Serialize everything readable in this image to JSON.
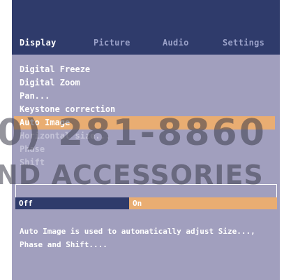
{
  "tabs": [
    {
      "label": "Display",
      "active": true
    },
    {
      "label": "Picture",
      "active": false
    },
    {
      "label": "Audio",
      "active": false
    },
    {
      "label": "Settings",
      "active": false
    }
  ],
  "menu": {
    "items": [
      {
        "label": "Digital Freeze",
        "state": "normal"
      },
      {
        "label": "Digital Zoom",
        "state": "normal"
      },
      {
        "label": "Pan...",
        "state": "normal"
      },
      {
        "label": "Keystone correction",
        "state": "normal"
      },
      {
        "label": "Auto Image",
        "state": "selected"
      },
      {
        "label": "Horizontal size...",
        "state": "disabled"
      },
      {
        "label": "Phase",
        "state": "disabled"
      },
      {
        "label": "Shift",
        "state": "disabled"
      }
    ]
  },
  "options": {
    "off_label": "Off",
    "on_label": "On",
    "selected": "On"
  },
  "help": {
    "line1": "Auto Image is used to automatically adjust Size...,",
    "line2": "Phase and Shift...."
  },
  "watermark": {
    "phone": "0) 281-8860",
    "text": "ND ACCESSORIES"
  },
  "colors": {
    "header": "#2f3b6b",
    "panel": "#a19fbe",
    "highlight": "#e9ad72",
    "text": "#ffffff"
  }
}
